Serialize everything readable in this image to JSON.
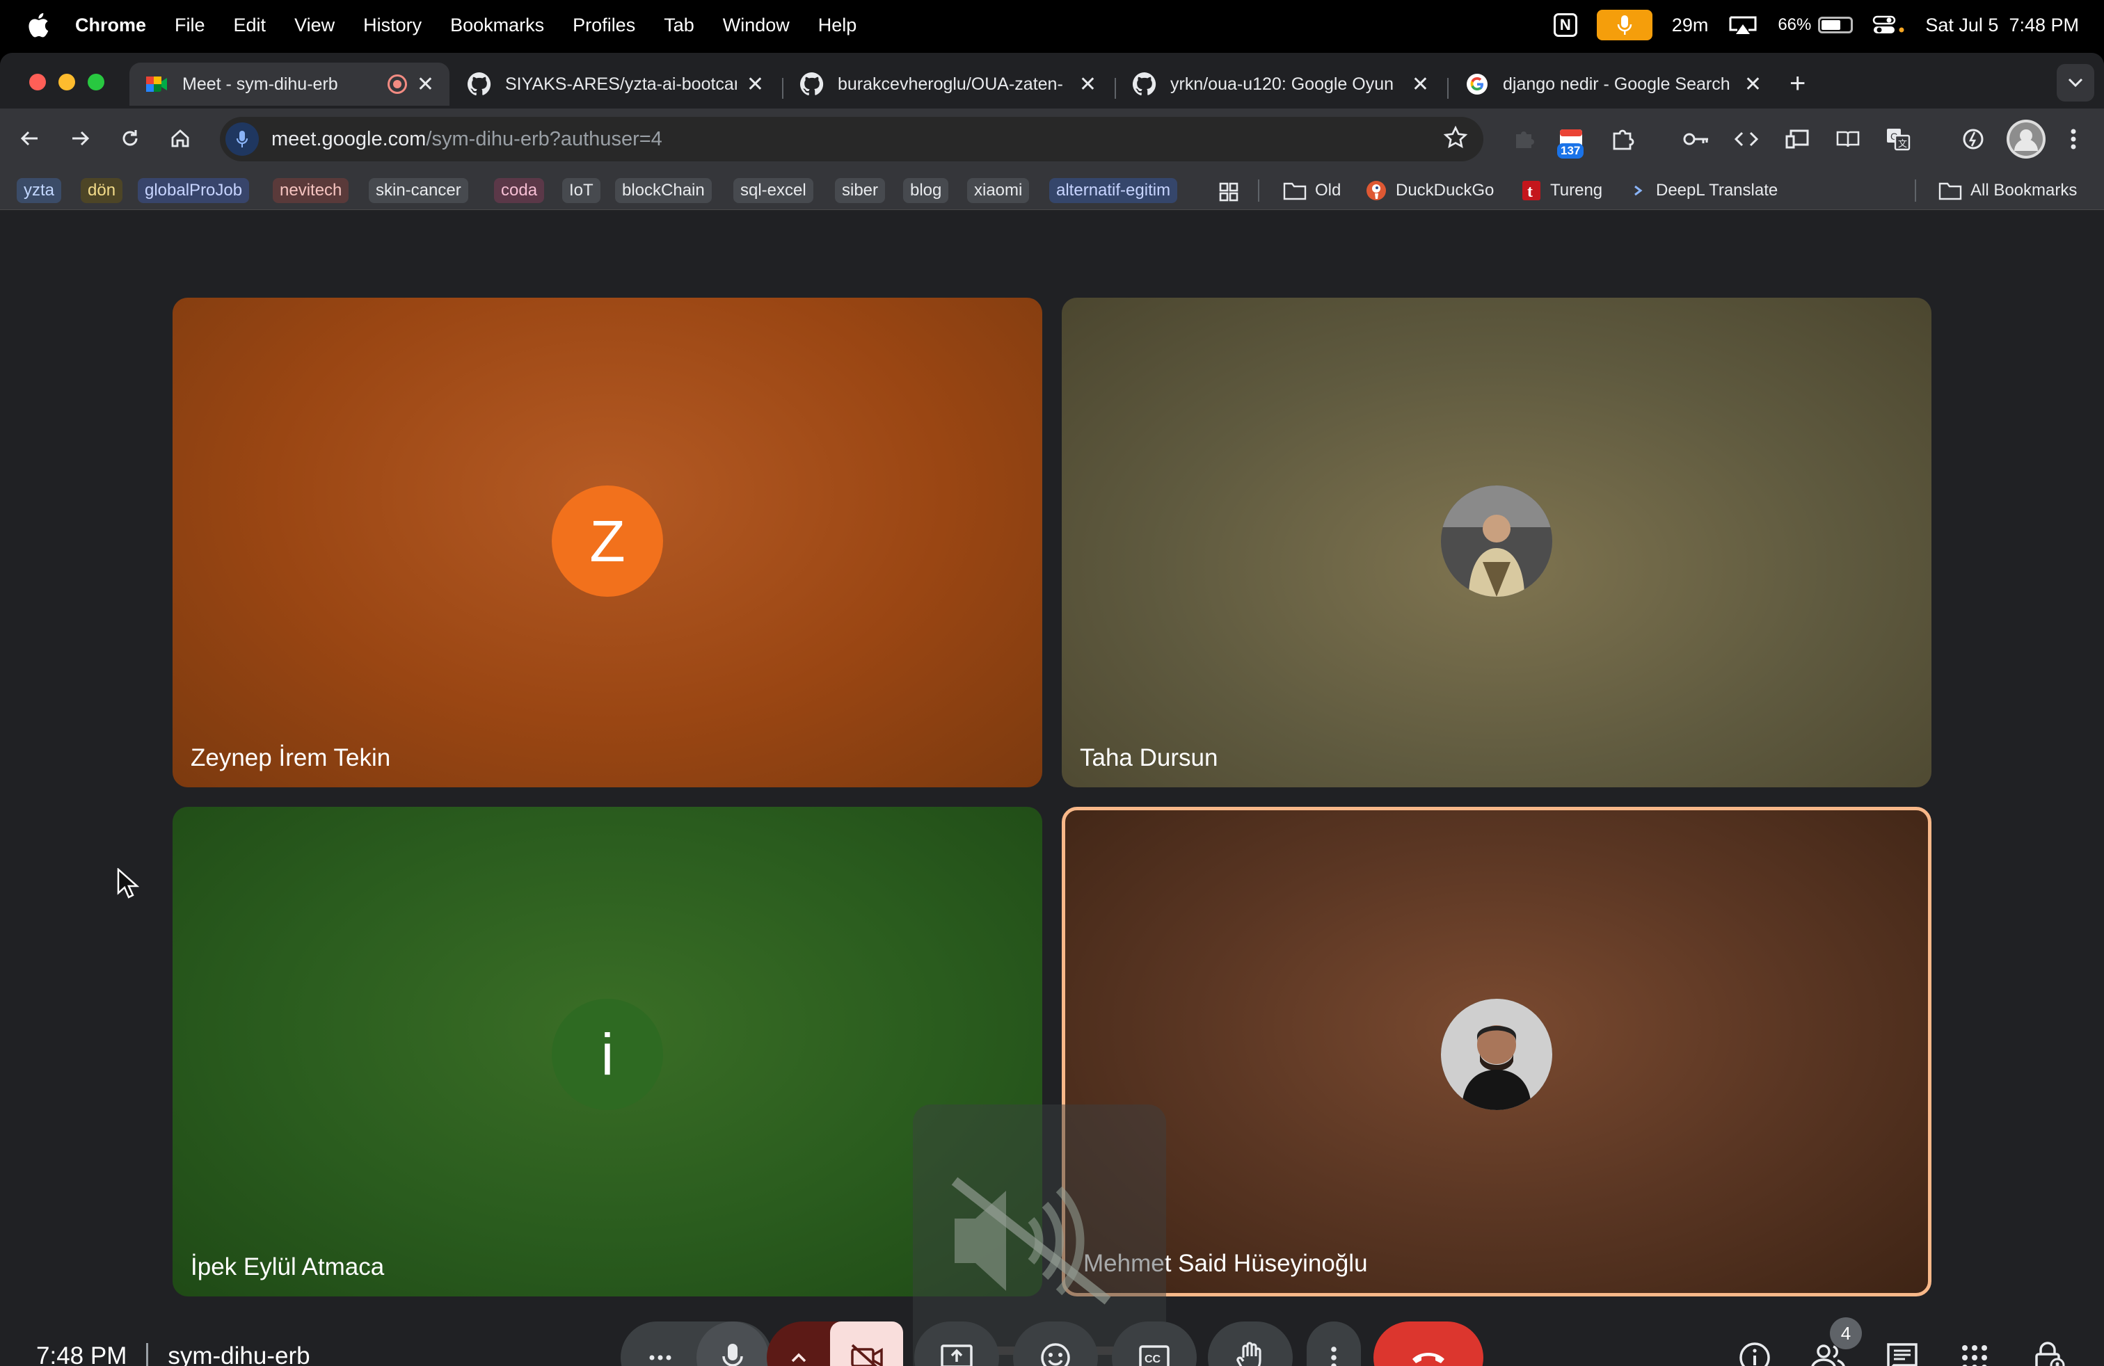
{
  "menubar": {
    "app": "Chrome",
    "menus": [
      "File",
      "Edit",
      "View",
      "History",
      "Bookmarks",
      "Profiles",
      "Tab",
      "Window",
      "Help"
    ],
    "timer": "29m",
    "battery": "66%",
    "battery_level": 0.66,
    "datetime": "Sat Jul 5  7:48 PM"
  },
  "tabs": [
    {
      "title": "Meet - sym-dihu-erb",
      "icon": "google-meet-icon",
      "active": true,
      "recording": true
    },
    {
      "title": "SIYAKS-ARES/yzta-ai-bootcamp",
      "icon": "github-icon"
    },
    {
      "title": "burakcevheroglu/OUA-zaten-",
      "icon": "github-icon"
    },
    {
      "title": "yrkn/oua-u120: Google Oyun",
      "icon": "github-icon"
    },
    {
      "title": "django nedir - Google Search",
      "icon": "google-icon"
    }
  ],
  "toolbar": {
    "url_domain": "meet.google.com",
    "url_path": "/sym-dihu-erb?authuser=4",
    "extension_badge": "137"
  },
  "bookmarks": {
    "tags": [
      {
        "label": "yzta",
        "color": "#3b4c68",
        "text": "#c2d7ff"
      },
      {
        "label": "dön",
        "color": "#4d4526",
        "text": "#f3dc8a"
      },
      {
        "label": "globalProJob",
        "color": "#38456b",
        "text": "#c7d4ff"
      },
      {
        "label": "nevitech",
        "color": "#5a3a3a",
        "text": "#f6c4c0"
      },
      {
        "label": "skin-cancer",
        "color": "#474a4f",
        "text": "#e8eaed"
      },
      {
        "label": "coda",
        "color": "#5b3848",
        "text": "#f6bfd4"
      },
      {
        "label": "IoT",
        "color": "#474a4f",
        "text": "#e8eaed"
      },
      {
        "label": "blockChain",
        "color": "#474a4f",
        "text": "#e8eaed"
      },
      {
        "label": "sql-excel",
        "color": "#474a4f",
        "text": "#e8eaed"
      },
      {
        "label": "siber",
        "color": "#474a4f",
        "text": "#e8eaed"
      },
      {
        "label": "blog",
        "color": "#474a4f",
        "text": "#e8eaed"
      },
      {
        "label": "xiaomi",
        "color": "#474a4f",
        "text": "#e8eaed"
      },
      {
        "label": "alternatif-egitim",
        "color": "#35466b",
        "text": "#c7d4ff"
      }
    ],
    "folders": [
      "Old",
      "DuckDuckGo",
      "Tureng",
      "DeepL Translate"
    ],
    "all": "All Bookmarks"
  },
  "participants": [
    {
      "name": "Zeynep İrem Tekin",
      "initial": "Z",
      "bg": "#b9541d",
      "avatar_color": "#f2711c"
    },
    {
      "name": "Taha Dursun",
      "initial": "",
      "bg": "#6a6342"
    },
    {
      "name": "İpek Eylül Atmaca",
      "initial": "i",
      "bg": "#2a5c1e",
      "avatar_color": "#2e6a22"
    },
    {
      "name": "Mehmet Said Hüseyinoğlu",
      "initial": "",
      "bg": "#5a3623",
      "speaking": true
    }
  ],
  "bottombar": {
    "time": "7:48 PM",
    "meeting_code": "sym-dihu-erb",
    "participant_count": "4"
  }
}
